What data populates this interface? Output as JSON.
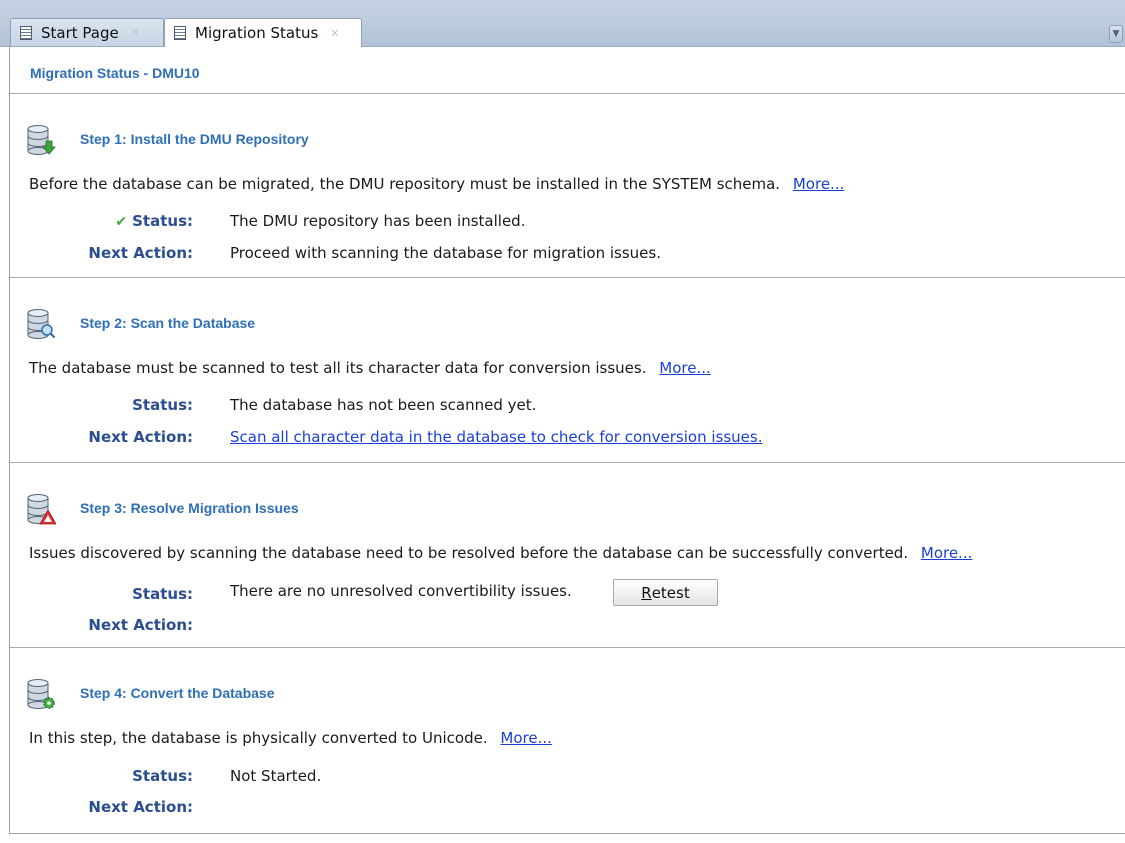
{
  "tabs": [
    {
      "label": "Start Page",
      "active": false
    },
    {
      "label": "Migration Status",
      "active": true
    }
  ],
  "page_title": "Migration Status - DMU10",
  "steps": [
    {
      "title": "Step 1: Install the DMU Repository",
      "icon": "database-download-icon",
      "description": "Before the database can be migrated, the DMU repository must be installed in the SYSTEM schema.",
      "more": "More...",
      "status_label": "Status:",
      "status": "The DMU repository has been installed.",
      "next_action_label": "Next Action:",
      "next_action": "Proceed with scanning the database for migration issues."
    },
    {
      "title": "Step 2: Scan the Database",
      "icon": "database-search-icon",
      "description": "The database must be scanned to test all its character data for conversion issues.",
      "more": "More...",
      "status_label": "Status:",
      "status": "The database has not been scanned yet.",
      "next_action_label": "Next Action:",
      "next_action": "Scan all character data in the database to check for conversion issues."
    },
    {
      "title": "Step 3: Resolve Migration Issues",
      "icon": "database-warning-icon",
      "description": "Issues discovered by scanning the database need to be resolved before the database can be successfully converted.",
      "more": "More...",
      "status_label": "Status:",
      "status": "There are no unresolved convertibility issues.",
      "button_mnemonic": "R",
      "button_rest": "etest",
      "next_action_label": "Next Action:"
    },
    {
      "title": "Step 4: Convert the Database",
      "icon": "database-convert-icon",
      "description": "In this step, the database is physically converted to Unicode.",
      "more": "More...",
      "status_label": "Status:",
      "status": "Not Started.",
      "next_action_label": "Next Action:"
    }
  ],
  "colors": {
    "heading": "#2e6fb5",
    "label": "#2b4f8e",
    "link": "#1a3fd6",
    "check": "#44a43a",
    "warning": "#e03030"
  }
}
